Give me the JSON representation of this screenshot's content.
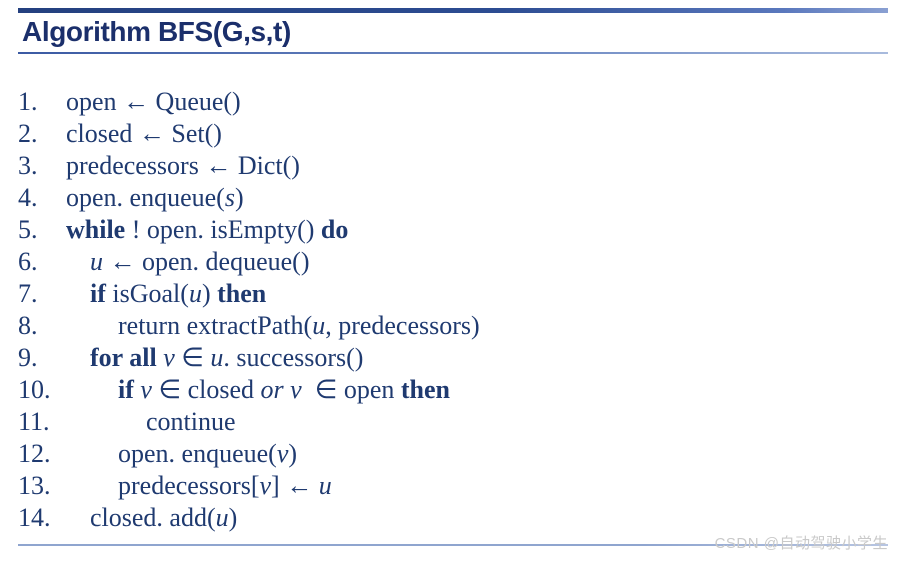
{
  "document": {
    "title": "Algorithm BFS(G,s,t)",
    "theme": {
      "text_color": "#1f3a70",
      "title_color": "#1b2f6b",
      "rule_color": "#24407f",
      "watermark_color": "#c9c9c9",
      "background": "#ffffff"
    }
  },
  "pseudocode": {
    "lines": [
      {
        "number": "1.",
        "indent": 0,
        "text": "open ← Queue()",
        "tokens": [
          {
            "t": "open ← Queue()",
            "style": "plain"
          }
        ]
      },
      {
        "number": "2.",
        "indent": 0,
        "text": "closed ← Set()",
        "tokens": [
          {
            "t": "closed ← Set()",
            "style": "plain"
          }
        ]
      },
      {
        "number": "3.",
        "indent": 0,
        "text": "predecessors ← Dict()",
        "tokens": [
          {
            "t": "predecessors ← Dict()",
            "style": "plain"
          }
        ]
      },
      {
        "number": "4.",
        "indent": 0,
        "text": "open. enqueue(s)",
        "tokens": [
          {
            "t": "open. enqueue(",
            "style": "plain"
          },
          {
            "t": "s",
            "style": "var"
          },
          {
            "t": ")",
            "style": "plain"
          }
        ]
      },
      {
        "number": "5.",
        "indent": 0,
        "text": "while ! open. isEmpty() do",
        "tokens": [
          {
            "t": "while",
            "style": "kw"
          },
          {
            "t": " ! open. isEmpty() ",
            "style": "plain"
          },
          {
            "t": "do",
            "style": "kw"
          }
        ]
      },
      {
        "number": "6.",
        "indent": 1,
        "text": "u ← open. dequeue()",
        "tokens": [
          {
            "t": "u",
            "style": "var"
          },
          {
            "t": " ← open. dequeue()",
            "style": "plain"
          }
        ]
      },
      {
        "number": "7.",
        "indent": 1,
        "text": "if isGoal(u) then",
        "tokens": [
          {
            "t": "if",
            "style": "kw"
          },
          {
            "t": " isGoal(",
            "style": "plain"
          },
          {
            "t": "u",
            "style": "var"
          },
          {
            "t": ") ",
            "style": "plain"
          },
          {
            "t": "then",
            "style": "kw"
          }
        ]
      },
      {
        "number": "8.",
        "indent": 2,
        "text": "return extractPath(u, predecessors)",
        "tokens": [
          {
            "t": "return extractPath(",
            "style": "plain"
          },
          {
            "t": "u",
            "style": "var"
          },
          {
            "t": ", predecessors)",
            "style": "plain"
          }
        ]
      },
      {
        "number": "9.",
        "indent": 1,
        "text": "for all v ∈ u. successors()",
        "tokens": [
          {
            "t": "for all",
            "style": "kw"
          },
          {
            "t": " ",
            "style": "plain"
          },
          {
            "t": "v",
            "style": "var"
          },
          {
            "t": " ∈ ",
            "style": "plain"
          },
          {
            "t": "u",
            "style": "var"
          },
          {
            "t": ". successors()",
            "style": "plain"
          }
        ]
      },
      {
        "number": "10.",
        "indent": 2,
        "text": "if v ∈ closed or v  ∈ open then",
        "tokens": [
          {
            "t": "if",
            "style": "kw"
          },
          {
            "t": " ",
            "style": "plain"
          },
          {
            "t": "v",
            "style": "var"
          },
          {
            "t": " ∈ closed ",
            "style": "plain"
          },
          {
            "t": "or",
            "style": "op"
          },
          {
            "t": " ",
            "style": "plain"
          },
          {
            "t": "v",
            "style": "var"
          },
          {
            "t": "  ∈ open ",
            "style": "plain"
          },
          {
            "t": "then",
            "style": "kw"
          }
        ]
      },
      {
        "number": "11.",
        "indent": 3,
        "text": "continue",
        "tokens": [
          {
            "t": "continue",
            "style": "plain"
          }
        ]
      },
      {
        "number": "12.",
        "indent": 2,
        "text": "open. enqueue(v)",
        "tokens": [
          {
            "t": "open. enqueue(",
            "style": "plain"
          },
          {
            "t": "v",
            "style": "var"
          },
          {
            "t": ")",
            "style": "plain"
          }
        ]
      },
      {
        "number": "13.",
        "indent": 2,
        "text": "predecessors[v] ← u",
        "tokens": [
          {
            "t": "predecessors[",
            "style": "plain"
          },
          {
            "t": "v",
            "style": "var"
          },
          {
            "t": "] ← ",
            "style": "plain"
          },
          {
            "t": "u",
            "style": "var"
          }
        ]
      },
      {
        "number": "14.",
        "indent": 1,
        "text": "closed. add(u)",
        "tokens": [
          {
            "t": "closed. add(",
            "style": "plain"
          },
          {
            "t": "u",
            "style": "var"
          },
          {
            "t": ")",
            "style": "plain"
          }
        ]
      }
    ]
  },
  "watermark": {
    "text": "CSDN @自动驾驶小学生"
  }
}
